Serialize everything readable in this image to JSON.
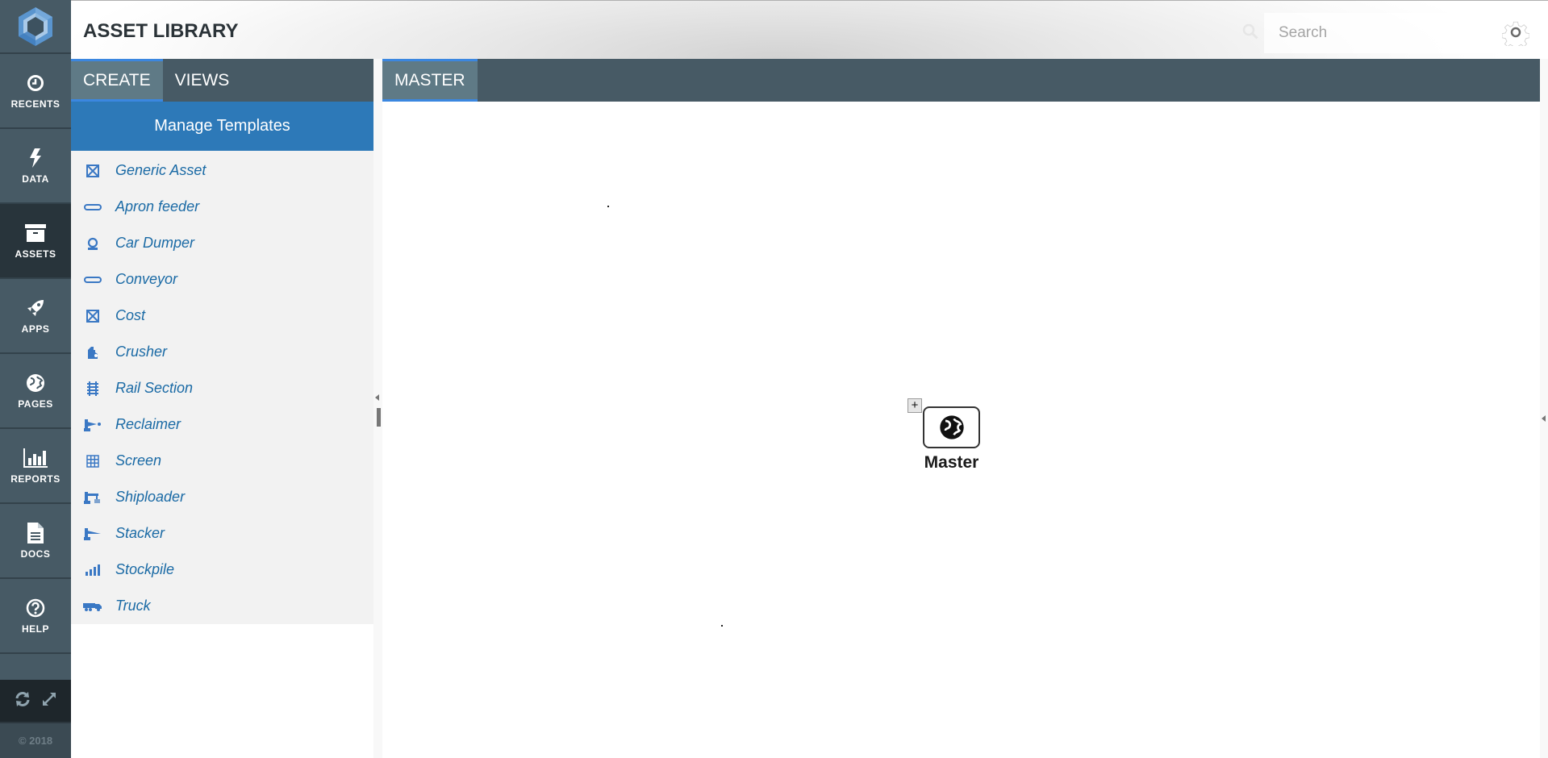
{
  "header": {
    "title": "ASSET LIBRARY",
    "search_placeholder": "Search",
    "search_value": ""
  },
  "nav": {
    "items": [
      {
        "label": "RECENTS",
        "icon": "clock-icon"
      },
      {
        "label": "DATA",
        "icon": "lightning-icon"
      },
      {
        "label": "ASSETS",
        "icon": "archive-box-icon",
        "active": true
      },
      {
        "label": "APPS",
        "icon": "rocket-icon"
      },
      {
        "label": "PAGES",
        "icon": "globe-icon"
      },
      {
        "label": "REPORTS",
        "icon": "bar-chart-icon"
      },
      {
        "label": "DOCS",
        "icon": "document-icon"
      },
      {
        "label": "HELP",
        "icon": "question-circle-icon"
      }
    ],
    "copyright": "© 2018"
  },
  "left_panel": {
    "tabs": [
      {
        "label": "CREATE",
        "active": true
      },
      {
        "label": "VIEWS",
        "active": false
      }
    ],
    "manage_button": "Manage Templates",
    "templates": [
      {
        "label": "Generic Asset",
        "icon": "box-x-icon"
      },
      {
        "label": "Apron feeder",
        "icon": "belt-icon"
      },
      {
        "label": "Car Dumper",
        "icon": "dumper-icon"
      },
      {
        "label": "Conveyor",
        "icon": "belt-icon"
      },
      {
        "label": "Cost",
        "icon": "box-x-icon"
      },
      {
        "label": "Crusher",
        "icon": "crusher-icon"
      },
      {
        "label": "Rail Section",
        "icon": "rail-icon"
      },
      {
        "label": "Reclaimer",
        "icon": "reclaimer-icon"
      },
      {
        "label": "Screen",
        "icon": "grid-icon"
      },
      {
        "label": "Shiploader",
        "icon": "shiploader-icon"
      },
      {
        "label": "Stacker",
        "icon": "stacker-icon"
      },
      {
        "label": "Stockpile",
        "icon": "stockpile-bars-icon"
      },
      {
        "label": "Truck",
        "icon": "truck-icon"
      }
    ]
  },
  "right_panel": {
    "tabs": [
      {
        "label": "MASTER",
        "active": true
      }
    ],
    "node": {
      "label": "Master",
      "icon": "globe-icon",
      "expand_symbol": "+"
    }
  },
  "colors": {
    "nav_bg": "#475a65",
    "nav_active": "#28343b",
    "tab_active": "#5f7a86",
    "accent_blue": "#3b87e0",
    "manage_button": "#2d79b8",
    "list_text": "#1a6aa5"
  }
}
